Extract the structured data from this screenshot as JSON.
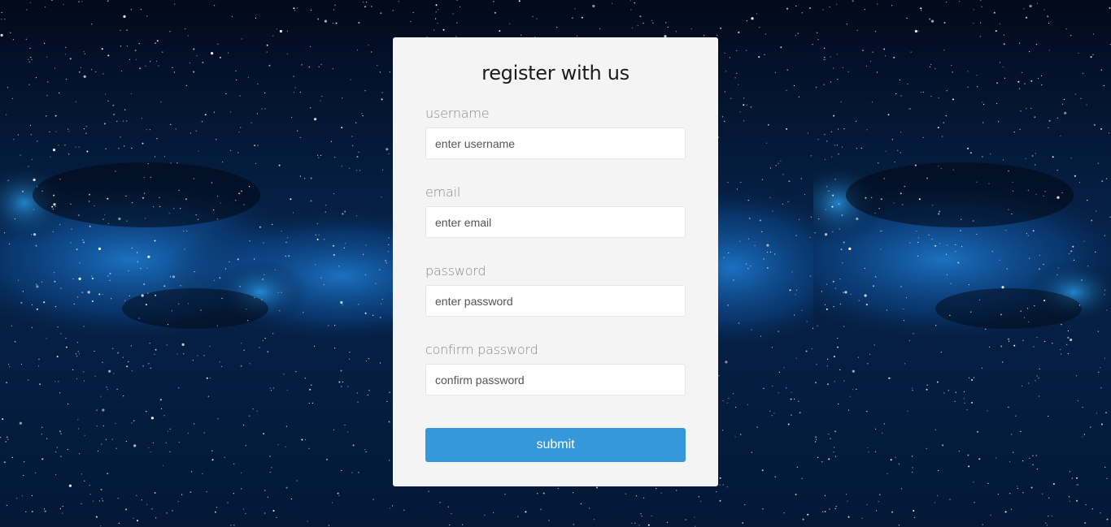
{
  "form": {
    "title": "register with us",
    "fields": [
      {
        "label": "username",
        "placeholder": "enter username",
        "type": "text"
      },
      {
        "label": "email",
        "placeholder": "enter email",
        "type": "email"
      },
      {
        "label": "password",
        "placeholder": "enter password",
        "type": "password"
      },
      {
        "label": "confirm password",
        "placeholder": "confirm password",
        "type": "password"
      }
    ],
    "submit_label": "submit"
  },
  "colors": {
    "card_background": "#f4f4f4",
    "submit_button": "#3498db",
    "background": "#031027"
  }
}
